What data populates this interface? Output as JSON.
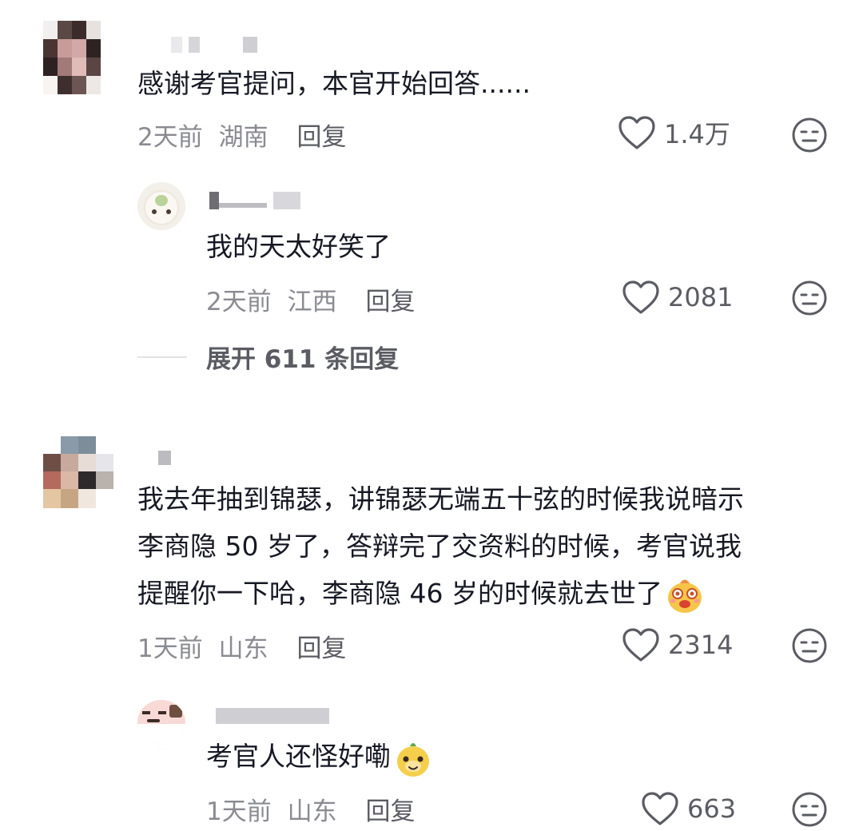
{
  "comments": [
    {
      "text": "感谢考官提问，本官开始回答......",
      "time": "2天前",
      "location": "湖南",
      "reply_label": "回复",
      "likes": "1.4万",
      "reply": {
        "text": "我的天太好笑了",
        "time": "2天前",
        "location": "江西",
        "reply_label": "回复",
        "likes": "2081"
      },
      "expand_label": "展开 611 条回复"
    },
    {
      "lines": [
        "我去年抽到锦瑟，讲锦瑟无端五十弦的时候我说暗示",
        "李商隐 50 岁了，答辩完了交资料的时候，考官说我",
        "提醒你一下哈，李商隐 46 岁的时候就去世了"
      ],
      "sticker_icon": "laughing-face-sticker",
      "time": "1天前",
      "location": "山东",
      "reply_label": "回复",
      "likes": "2314",
      "reply": {
        "text": "考官人还怪好嘞",
        "sticker_icon": "smiling-face-sticker",
        "time": "1天前",
        "location": "山东",
        "reply_label": "回复",
        "likes": "663"
      }
    }
  ],
  "icons": {
    "like": "heart-outline-icon",
    "dislike": "meh-face-icon"
  },
  "colors": {
    "text": "#161823",
    "meta": "#8a8b91",
    "action": "#5b5c63",
    "divider": "#e3e3e6"
  }
}
